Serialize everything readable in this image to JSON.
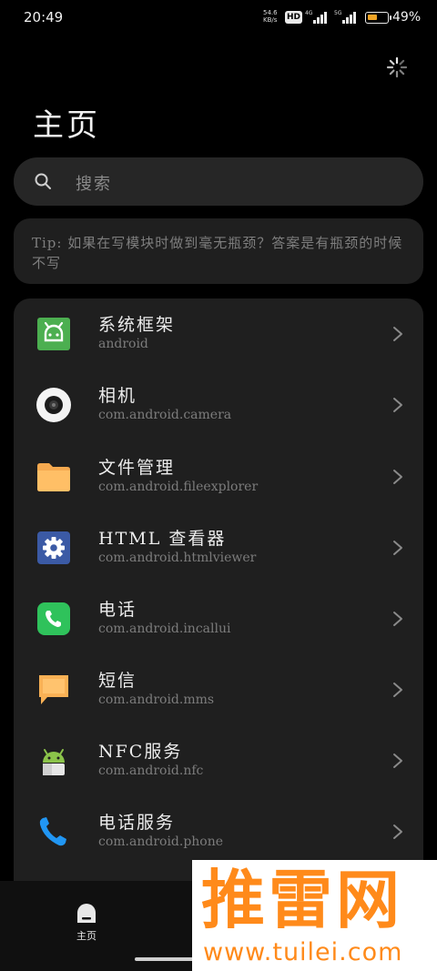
{
  "status_bar": {
    "time": "20:49",
    "net_speed": "54.6",
    "net_unit": "KB/s",
    "hd_label": "HD",
    "signal1_tag": "4G",
    "signal2_tag": "5G",
    "battery_percent": "49%",
    "battery_level": 0.49,
    "battery_color": "#f0a526"
  },
  "header": {
    "title": "主页",
    "loader_icon": "spinner-icon"
  },
  "search": {
    "placeholder": "搜索",
    "icon": "search-icon"
  },
  "tip": {
    "text": "Tip: 如果在写模块时做到毫无瓶颈？答案是有瓶颈的时候不写"
  },
  "apps": [
    {
      "name": "系统框架",
      "package": "android",
      "icon": "android-framework-icon"
    },
    {
      "name": "相机",
      "package": "com.android.camera",
      "icon": "camera-icon"
    },
    {
      "name": "文件管理",
      "package": "com.android.fileexplorer",
      "icon": "folder-icon"
    },
    {
      "name": "HTML 查看器",
      "package": "com.android.htmlviewer",
      "icon": "gear-icon"
    },
    {
      "name": "电话",
      "package": "com.android.incallui",
      "icon": "phone-icon"
    },
    {
      "name": "短信",
      "package": "com.android.mms",
      "icon": "message-icon"
    },
    {
      "name": "NFC服务",
      "package": "com.android.nfc",
      "icon": "android-robot-icon"
    },
    {
      "name": "电话服务",
      "package": "com.android.phone",
      "icon": "phone-handset-icon"
    }
  ],
  "bottom_nav": {
    "home_label": "主页",
    "home_icon": "home-icon"
  },
  "watermark": {
    "brand": "推雷网",
    "url": "www.tuilei.com"
  },
  "colors": {
    "background": "#000000",
    "card": "#1f1f1f",
    "search_bg": "#262626",
    "accent_orange": "#ff8a1a"
  }
}
